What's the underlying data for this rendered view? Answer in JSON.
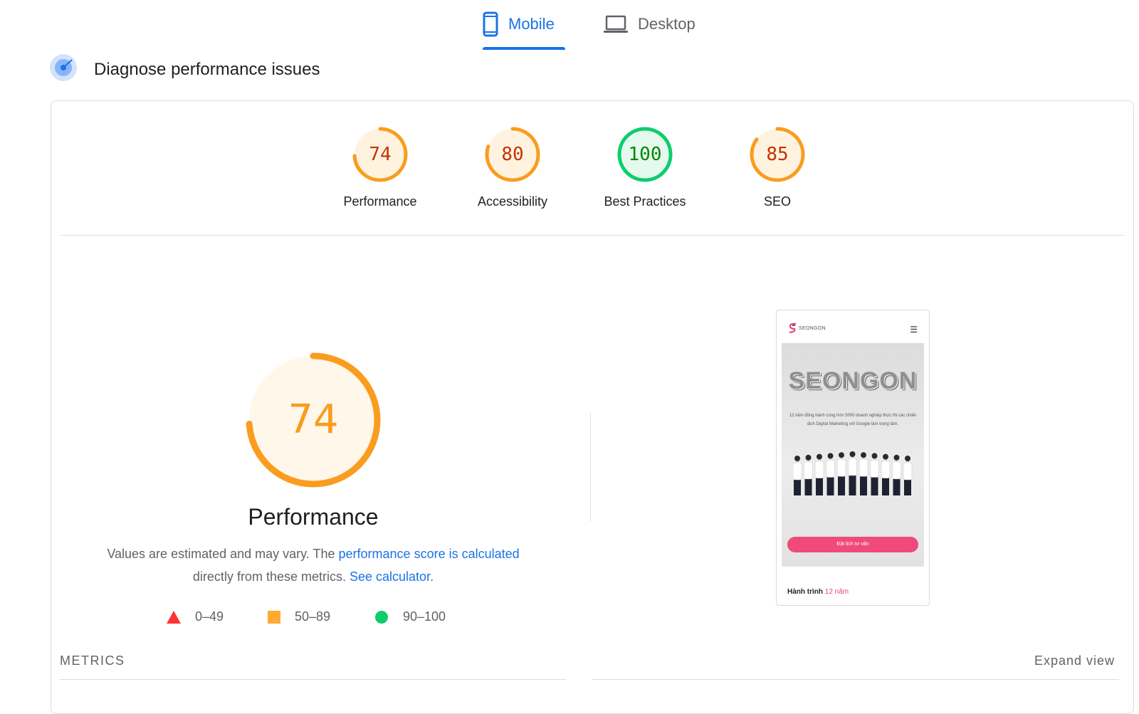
{
  "tabs": [
    {
      "label": "Mobile",
      "active": true
    },
    {
      "label": "Desktop",
      "active": false
    }
  ],
  "section_title": "Diagnose performance issues",
  "categories": [
    {
      "label": "Performance",
      "score": "74",
      "value": 74,
      "color": "#fa9c1e",
      "text_color": "#c33300",
      "bg": "#fff3e0"
    },
    {
      "label": "Accessibility",
      "score": "80",
      "value": 80,
      "color": "#fa9c1e",
      "text_color": "#c33300",
      "bg": "#fff3e0"
    },
    {
      "label": "Best Practices",
      "score": "100",
      "value": 100,
      "color": "#0cce6b",
      "text_color": "#008800",
      "bg": "#e6f9ee"
    },
    {
      "label": "SEO",
      "score": "85",
      "value": 85,
      "color": "#fa9c1e",
      "text_color": "#c33300",
      "bg": "#fff3e0"
    }
  ],
  "main": {
    "score": "74",
    "score_value": 74,
    "title": "Performance",
    "desc_prefix": "Values are estimated and may vary. The ",
    "desc_link1": "performance score is calculated",
    "desc_middle": " directly from these metrics. ",
    "desc_link2": "See calculator",
    "desc_suffix": ".",
    "legend": [
      {
        "range": "0–49",
        "shape": "triangle",
        "color": "#ff3333"
      },
      {
        "range": "50–89",
        "shape": "square",
        "color": "#ffaa33"
      },
      {
        "range": "90–100",
        "shape": "circle",
        "color": "#0cce6b"
      }
    ]
  },
  "metrics_label": "METRICS",
  "expand_label": "Expand view",
  "thumbnail": {
    "logo_text": "SEONGON",
    "hero_title": "SEONGON",
    "hero_sub": "12 năm đồng hành cùng hơn 5000 doanh nghiệp thực thi các chiến dịch Digital Marketing với Google làm trọng tâm.",
    "cta": "Đặt lịch tư vấn",
    "journey_prefix": "Hành trình ",
    "journey_highlight": "12 năm"
  },
  "colors": {
    "accent": "#1a73e8",
    "average": "#fa9c1e",
    "pass": "#0cce6b",
    "fail": "#ff3333"
  }
}
